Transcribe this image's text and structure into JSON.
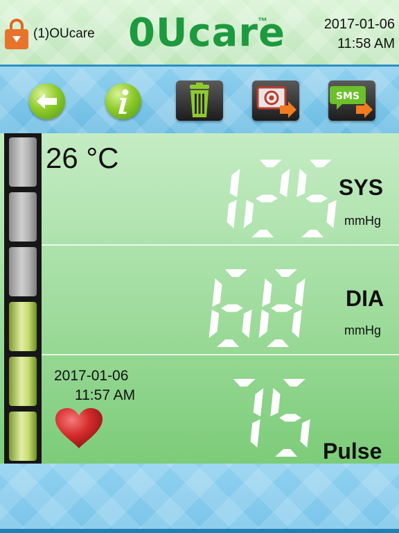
{
  "header": {
    "user_label": "(1)OUcare",
    "logo_text": "0Ucare",
    "trademark": "™",
    "date": "2017-01-06",
    "time": "11:58 AM",
    "logo_color": "#1d9a3e"
  },
  "toolbar": {
    "buttons": [
      {
        "name": "back",
        "icon": "arrow-left-icon"
      },
      {
        "name": "info",
        "icon": "info-icon"
      },
      {
        "name": "delete",
        "icon": "trash-icon"
      },
      {
        "name": "email",
        "icon": "email-icon"
      },
      {
        "name": "sms",
        "icon": "sms-icon",
        "label": "SMS"
      }
    ]
  },
  "reading": {
    "temperature": "26 °C",
    "sys": {
      "value": "125",
      "label": "SYS",
      "unit": "mmHg"
    },
    "dia": {
      "value": "68",
      "label": "DIA",
      "unit": "mmHg"
    },
    "pulse": {
      "value": "75",
      "label": "Pulse"
    },
    "measured_date": "2017-01-06",
    "measured_time": "11:57 AM",
    "indicator_level": 3,
    "indicator_total": 6
  }
}
